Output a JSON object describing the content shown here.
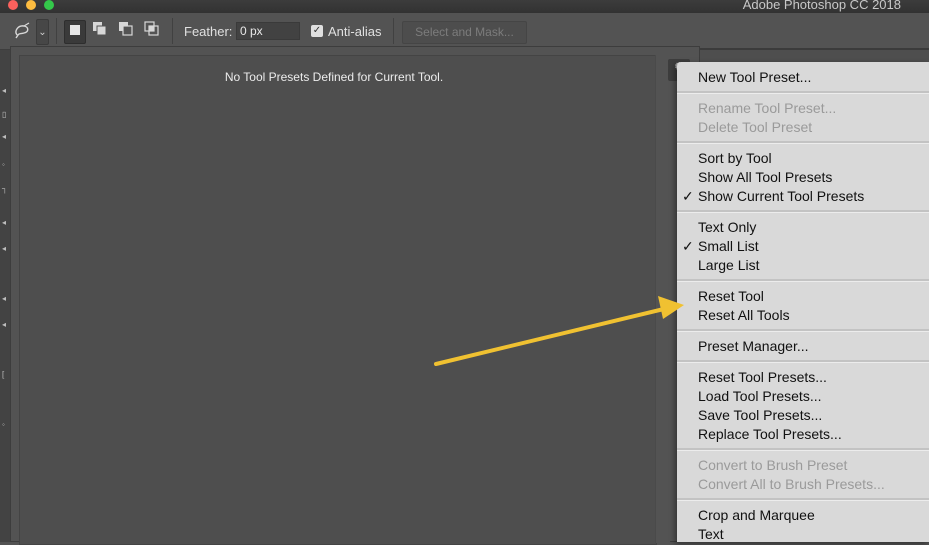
{
  "window": {
    "app_title": "Adobe Photoshop CC 2018"
  },
  "options_bar": {
    "tool_icon": "lasso-tool-icon",
    "mode_icons": [
      "new-selection-icon",
      "add-to-selection-icon",
      "subtract-from-selection-icon",
      "intersect-selection-icon"
    ],
    "feather_label": "Feather:",
    "feather_value": "0 px",
    "antialias_label": "Anti-alias",
    "antialias_checked": true,
    "select_and_mask_label": "Select and Mask..."
  },
  "presets_panel": {
    "empty_message": "No Tool Presets Defined for Current Tool."
  },
  "flyout_menu": {
    "groups": [
      [
        {
          "label": "New Tool Preset...",
          "enabled": true,
          "checked": false
        }
      ],
      [
        {
          "label": "Rename Tool Preset...",
          "enabled": false,
          "checked": false
        },
        {
          "label": "Delete Tool Preset",
          "enabled": false,
          "checked": false
        }
      ],
      [
        {
          "label": "Sort by Tool",
          "enabled": true,
          "checked": false
        },
        {
          "label": "Show All Tool Presets",
          "enabled": true,
          "checked": false
        },
        {
          "label": "Show Current Tool Presets",
          "enabled": true,
          "checked": true
        }
      ],
      [
        {
          "label": "Text Only",
          "enabled": true,
          "checked": false
        },
        {
          "label": "Small List",
          "enabled": true,
          "checked": true
        },
        {
          "label": "Large List",
          "enabled": true,
          "checked": false
        }
      ],
      [
        {
          "label": "Reset Tool",
          "enabled": true,
          "checked": false
        },
        {
          "label": "Reset All Tools",
          "enabled": true,
          "checked": false
        }
      ],
      [
        {
          "label": "Preset Manager...",
          "enabled": true,
          "checked": false
        }
      ],
      [
        {
          "label": "Reset Tool Presets...",
          "enabled": true,
          "checked": false
        },
        {
          "label": "Load Tool Presets...",
          "enabled": true,
          "checked": false
        },
        {
          "label": "Save Tool Presets...",
          "enabled": true,
          "checked": false
        },
        {
          "label": "Replace Tool Presets...",
          "enabled": true,
          "checked": false
        }
      ],
      [
        {
          "label": "Convert to Brush Preset",
          "enabled": false,
          "checked": false
        },
        {
          "label": "Convert All to Brush Presets...",
          "enabled": false,
          "checked": false
        }
      ],
      [
        {
          "label": "Crop and Marquee",
          "enabled": true,
          "checked": false
        },
        {
          "label": "Text",
          "enabled": true,
          "checked": false
        }
      ]
    ],
    "check_glyph": "✓"
  },
  "colors": {
    "annotation_arrow": "#f0c131",
    "menu_bg": "#d9d9d9",
    "disabled_text": "#9a9a9a"
  }
}
